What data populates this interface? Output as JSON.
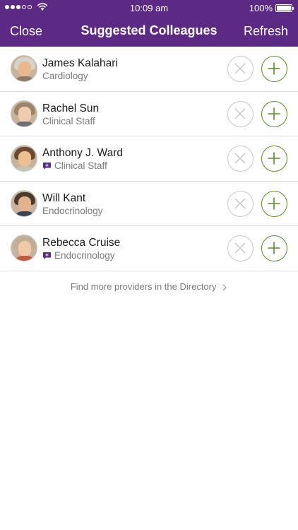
{
  "status": {
    "time": "10:09 am",
    "battery": "100%"
  },
  "nav": {
    "left": "Close",
    "title": "Suggested Colleagues",
    "right": "Refresh"
  },
  "colleagues": [
    {
      "name": "James Kalahari",
      "specialty": "Cardiology",
      "has_message": false
    },
    {
      "name": "Rachel Sun",
      "specialty": "Clinical Staff",
      "has_message": false
    },
    {
      "name": "Anthony J. Ward",
      "specialty": "Clinical Staff",
      "has_message": true
    },
    {
      "name": "Will Kant",
      "specialty": "Endocrinology",
      "has_message": false
    },
    {
      "name": "Rebecca Cruise",
      "specialty": "Endocrinology",
      "has_message": true
    }
  ],
  "footer": {
    "link": "Find more providers in the Directory"
  },
  "icons": {
    "dismiss": "x-icon",
    "add": "plus-icon",
    "message": "message-badge-icon",
    "chevron": "chevron-right-icon"
  },
  "colors": {
    "header": "#5c2a84",
    "add_accent": "#5c8a2a",
    "dismiss_gray": "#c9c9c9"
  }
}
